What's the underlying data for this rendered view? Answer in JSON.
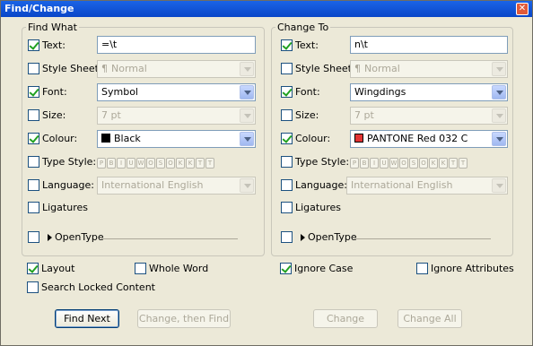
{
  "window": {
    "title": "Find/Change",
    "close": "✕"
  },
  "find_what": {
    "title": "Find What",
    "text": {
      "label": "Text:",
      "checked": true,
      "value": "=\\t"
    },
    "style_sheet": {
      "label": "Style Sheet:",
      "checked": false,
      "value": "Normal"
    },
    "font": {
      "label": "Font:",
      "checked": true,
      "value": "Symbol"
    },
    "size": {
      "label": "Size:",
      "checked": false,
      "value": "7 pt"
    },
    "colour": {
      "label": "Colour:",
      "checked": true,
      "value": "Black",
      "swatch": "#000000"
    },
    "type_style": {
      "label": "Type Style:",
      "checked": false,
      "icons": [
        "P",
        "B",
        "I",
        "U",
        "W",
        "O",
        "S",
        "O",
        "K",
        "K",
        "T",
        "T"
      ]
    },
    "language": {
      "label": "Language:",
      "checked": false,
      "value": "International English"
    },
    "ligatures": {
      "label": "Ligatures",
      "checked": false
    },
    "opentype": {
      "label": "OpenType",
      "checked": false
    }
  },
  "change_to": {
    "title": "Change To",
    "text": {
      "label": "Text:",
      "checked": true,
      "value": "n\\t"
    },
    "style_sheet": {
      "label": "Style Sheet:",
      "checked": false,
      "value": "Normal"
    },
    "font": {
      "label": "Font:",
      "checked": true,
      "value": "Wingdings"
    },
    "size": {
      "label": "Size:",
      "checked": false,
      "value": "7 pt"
    },
    "colour": {
      "label": "Colour:",
      "checked": true,
      "value": "PANTONE Red 032 C",
      "swatch": "#e23434"
    },
    "type_style": {
      "label": "Type Style:",
      "checked": false,
      "icons": [
        "P",
        "B",
        "I",
        "U",
        "W",
        "O",
        "S",
        "O",
        "K",
        "K",
        "T",
        "T"
      ]
    },
    "language": {
      "label": "Language:",
      "checked": false,
      "value": "International English"
    },
    "ligatures": {
      "label": "Ligatures",
      "checked": false
    },
    "opentype": {
      "label": "OpenType",
      "checked": false
    }
  },
  "options": {
    "layout": {
      "label": "Layout",
      "checked": true
    },
    "whole_word": {
      "label": "Whole Word",
      "checked": false
    },
    "ignore_case": {
      "label": "Ignore Case",
      "checked": true
    },
    "ignore_attributes": {
      "label": "Ignore Attributes",
      "checked": false
    },
    "search_locked": {
      "label": "Search Locked Content",
      "checked": false
    }
  },
  "buttons": {
    "find_next": "Find Next",
    "change_then_find": "Change, then Find",
    "change": "Change",
    "change_all": "Change All"
  },
  "glyphs": {
    "pilcrow": "¶"
  }
}
